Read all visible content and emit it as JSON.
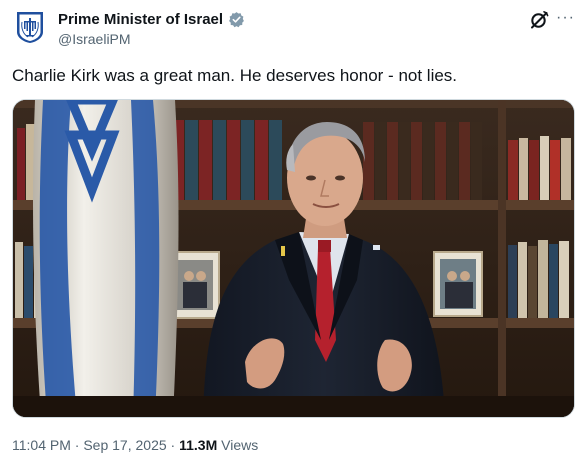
{
  "post": {
    "author": {
      "display_name": "Prime Minister of Israel",
      "handle": "@IsraeliPM",
      "verified": true,
      "verified_color": "#829aab",
      "avatar_icon": "israel-emblem-icon"
    },
    "actions": {
      "grok_icon": "grok-icon",
      "more_label": "···"
    },
    "text": "Charlie Kirk was a great man. He deserves honor - not lies.",
    "media": {
      "type": "video"
    },
    "footer": {
      "time": "11:04 PM",
      "separator": "·",
      "date": "Sep 17, 2025",
      "views_count": "11.3M",
      "views_label": "Views"
    }
  }
}
